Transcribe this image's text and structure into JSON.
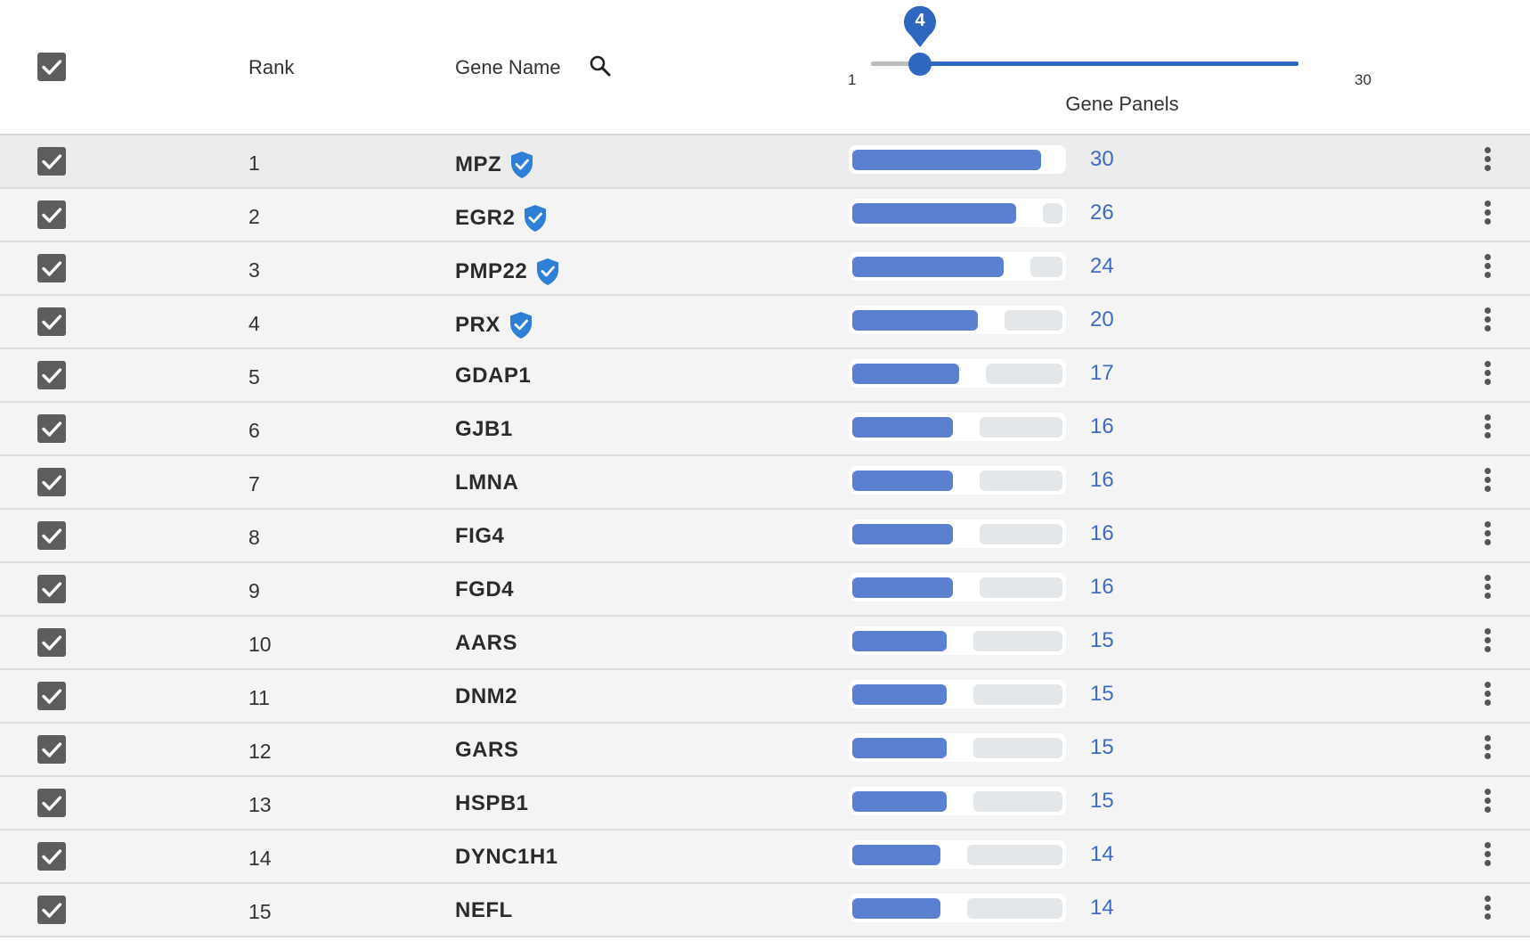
{
  "header": {
    "rank_label": "Rank",
    "gene_label": "Gene Name",
    "slider": {
      "value": "4",
      "min": "1",
      "max": "30",
      "label": "Gene Panels",
      "value_fraction": 0.103
    }
  },
  "colors": {
    "accent": "#2f66c0",
    "bar_fill": "#5b7fd1",
    "bar_track": "#e4e7ea",
    "count_text": "#3f6bc6",
    "checkbox": "#5d5d5d"
  },
  "icons": {
    "header_search": "search-icon",
    "verified": "verified-shield-icon",
    "row_menu": "kebab-menu-icon",
    "checkbox": "checkbox-checked-icon"
  },
  "rows": [
    {
      "rank": "1",
      "gene": "MPZ",
      "verified": true,
      "count": "30",
      "fraction": 1.0
    },
    {
      "rank": "2",
      "gene": "EGR2",
      "verified": true,
      "count": "26",
      "fraction": 0.867
    },
    {
      "rank": "3",
      "gene": "PMP22",
      "verified": true,
      "count": "24",
      "fraction": 0.8
    },
    {
      "rank": "4",
      "gene": "PRX",
      "verified": true,
      "count": "20",
      "fraction": 0.667
    },
    {
      "rank": "5",
      "gene": "GDAP1",
      "verified": false,
      "count": "17",
      "fraction": 0.567
    },
    {
      "rank": "6",
      "gene": "GJB1",
      "verified": false,
      "count": "16",
      "fraction": 0.533
    },
    {
      "rank": "7",
      "gene": "LMNA",
      "verified": false,
      "count": "16",
      "fraction": 0.533
    },
    {
      "rank": "8",
      "gene": "FIG4",
      "verified": false,
      "count": "16",
      "fraction": 0.533
    },
    {
      "rank": "9",
      "gene": "FGD4",
      "verified": false,
      "count": "16",
      "fraction": 0.533
    },
    {
      "rank": "10",
      "gene": "AARS",
      "verified": false,
      "count": "15",
      "fraction": 0.5
    },
    {
      "rank": "11",
      "gene": "DNM2",
      "verified": false,
      "count": "15",
      "fraction": 0.5
    },
    {
      "rank": "12",
      "gene": "GARS",
      "verified": false,
      "count": "15",
      "fraction": 0.5
    },
    {
      "rank": "13",
      "gene": "HSPB1",
      "verified": false,
      "count": "15",
      "fraction": 0.5
    },
    {
      "rank": "14",
      "gene": "DYNC1H1",
      "verified": false,
      "count": "14",
      "fraction": 0.467
    },
    {
      "rank": "15",
      "gene": "NEFL",
      "verified": false,
      "count": "14",
      "fraction": 0.467
    }
  ]
}
